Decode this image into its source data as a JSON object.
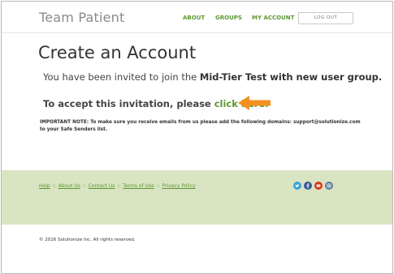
{
  "header": {
    "logo": "Team Patient",
    "nav": {
      "about": "ABOUT",
      "groups": "GROUPS",
      "my_account": "MY ACCOUNT"
    },
    "logout_label": "LOG OUT"
  },
  "main": {
    "title": "Create an Account",
    "invite_prefix": "You have been invited to join the ",
    "invite_group": "Mid-Tier Test with new user group.",
    "accept_prefix": "To accept this invitation, please ",
    "accept_link": "click here.",
    "note": "IMPORTANT NOTE: To make sure you receive emails from us please add the following domains: support@solutionize.com to your Safe Senders list."
  },
  "footer": {
    "links": [
      "Help",
      "About Us",
      "Contact Us",
      "Terms of Use",
      "Privacy Policy"
    ],
    "separator": "::",
    "social": [
      "twitter-icon",
      "facebook-icon",
      "youtube-icon",
      "instagram-icon"
    ],
    "social_colors": {
      "twitter": "#3aa1d9",
      "facebook": "#3b5998",
      "youtube": "#d9331f",
      "instagram": "#5a7a96"
    },
    "copyright": "© 2016 Solutionize Inc. All rights reserved."
  },
  "colors": {
    "accent": "#5f9730",
    "arrow": "#f39120",
    "footer_band": "#d9e4c2"
  }
}
